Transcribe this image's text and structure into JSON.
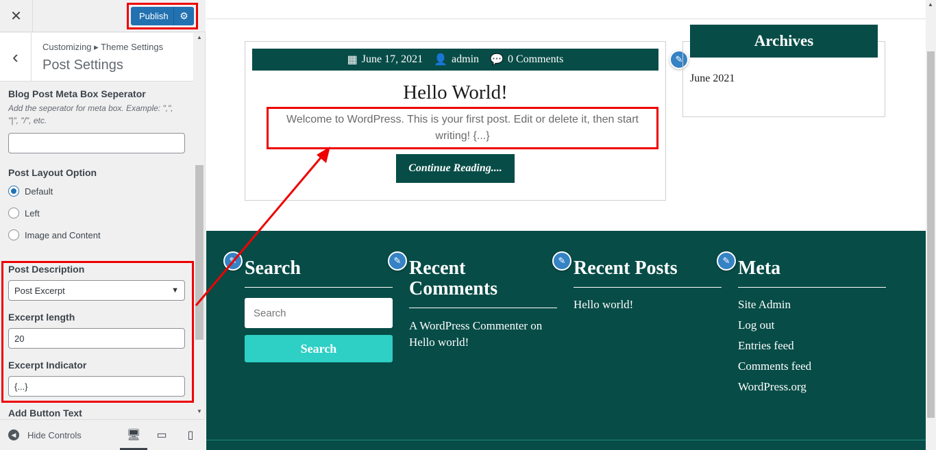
{
  "sidebar": {
    "close_label": "✕",
    "publish_label": "Publish",
    "breadcrumb": "Customizing ▸ Theme Settings",
    "title": "Post Settings",
    "meta_separator": {
      "label": "Blog Post Meta Box Seperator",
      "description": "Add the seperator for meta box. Example: \",\", \"|\", \"/\", etc.",
      "value": ""
    },
    "layout": {
      "label": "Post Layout Option",
      "options": [
        "Default",
        "Left",
        "Image and Content"
      ],
      "selected": "Default"
    },
    "description": {
      "label": "Post Description",
      "selected": "Post Excerpt"
    },
    "excerpt_length": {
      "label": "Excerpt length",
      "value": "20"
    },
    "excerpt_indicator": {
      "label": "Excerpt Indicator",
      "value": "{...}"
    },
    "button_text": {
      "label": "Add Button Text"
    },
    "hide_controls": "Hide Controls"
  },
  "preview": {
    "post": {
      "date": "June 17, 2021",
      "author": "admin",
      "comments": "0 Comments",
      "title": "Hello World!",
      "excerpt": "Welcome to WordPress. This is your first post. Edit or delete it, then start writing! {...}",
      "read_more": "Continue Reading...."
    },
    "archives": {
      "title": "Archives",
      "items": [
        "June 2021"
      ]
    },
    "footer": {
      "search": {
        "title": "Search",
        "placeholder": "Search",
        "button": "Search"
      },
      "recent_comments": {
        "title": "Recent Comments",
        "items": [
          "A WordPress Commenter on Hello world!"
        ]
      },
      "recent_posts": {
        "title": "Recent Posts",
        "items": [
          "Hello world!"
        ]
      },
      "meta": {
        "title": "Meta",
        "items": [
          "Site Admin",
          "Log out",
          "Entries feed",
          "Comments feed",
          "WordPress.org"
        ]
      }
    }
  },
  "colors": {
    "brand_dark_teal": "#074c47",
    "accent_teal": "#2ecfc4",
    "wp_blue": "#2271b1",
    "highlight_red": "#e00000"
  }
}
